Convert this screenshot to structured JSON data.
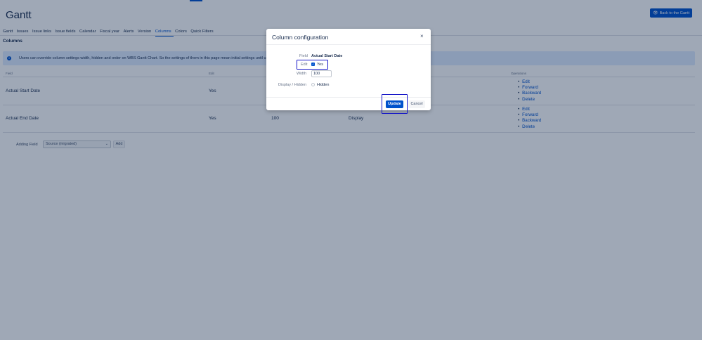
{
  "page": {
    "title": "Gantt",
    "back_button": "Back to the Gantt",
    "section_title": "Columns",
    "info_text": "Users can override column settings width, hidden and order on WBS Gantt Chart. So the settings of them in this page mean initial settings until us"
  },
  "tabs": [
    "Gantt",
    "Issues",
    "Issue links",
    "Issue fields",
    "Calendar",
    "Fiscal year",
    "Alerts",
    "Version",
    "Columns",
    "Colors",
    "Quick Filters"
  ],
  "active_tab": "Columns",
  "table": {
    "headers": {
      "field": "Field",
      "edit": "Edit",
      "operations": "Operations"
    },
    "rows": [
      {
        "field": "Actual Start Date",
        "edit": "Yes",
        "width": "",
        "display": ""
      },
      {
        "field": "Actual End Date",
        "edit": "Yes",
        "width": "100",
        "display": "Display"
      }
    ],
    "operations": [
      "Edit",
      "Forward",
      "Backward",
      "Delete"
    ]
  },
  "adding": {
    "label": "Adding Field",
    "selected": "Source (migrated)",
    "add_button": "Add"
  },
  "modal": {
    "title": "Column configuration",
    "close": "×",
    "field_label": "Field",
    "field_value": "Actual Start Date",
    "edit_label": "Edit",
    "edit_option": "Yes",
    "width_label": "Width",
    "width_value": "100",
    "display_label": "Display / Hidden",
    "display_option": "Hidden",
    "update_button": "Update",
    "cancel_button": "Cancel"
  },
  "colors": {
    "accent": "#0052cc",
    "info_bg": "#deebff",
    "highlight": "#1414c8"
  }
}
